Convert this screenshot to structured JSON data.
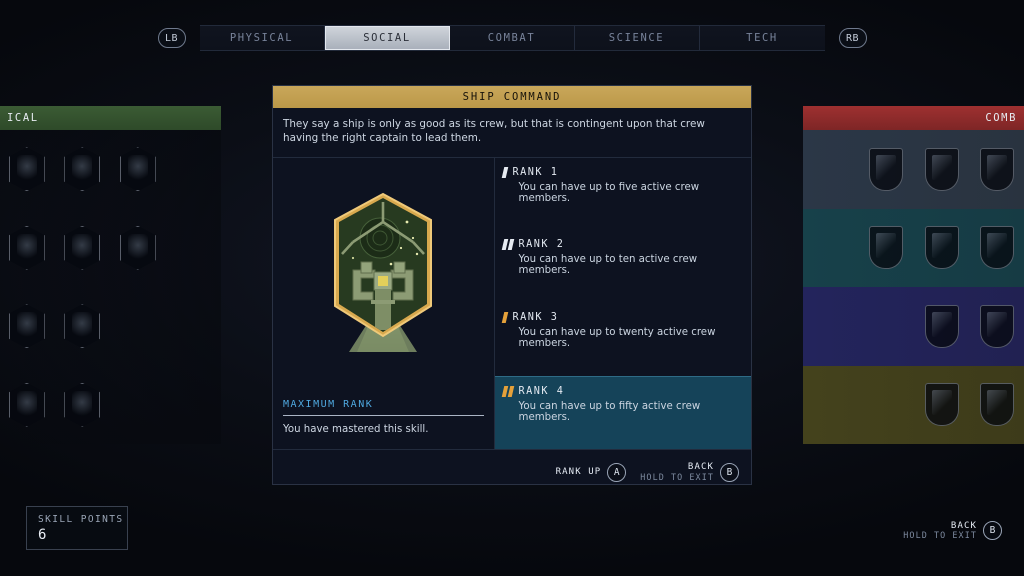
{
  "nav": {
    "left_bumper": "LB",
    "right_bumper": "RB",
    "tabs": [
      {
        "label": "PHYSICAL",
        "active": false
      },
      {
        "label": "SOCIAL",
        "active": true
      },
      {
        "label": "COMBAT",
        "active": false
      },
      {
        "label": "SCIENCE",
        "active": false
      },
      {
        "label": "TECH",
        "active": false
      }
    ]
  },
  "left_panel": {
    "header": "ICAL"
  },
  "right_panel": {
    "header": "COMB"
  },
  "skill": {
    "title": "SHIP COMMAND",
    "description": "They say a ship is only as good as its crew, but that is contingent upon that crew having the right captain to lead them.",
    "max_rank": {
      "title": "MAXIMUM RANK",
      "text": "You have mastered this skill."
    },
    "ranks": [
      {
        "label": "RANK 1",
        "desc": "You can have up to five active crew members.",
        "pips": 1,
        "pip_color": "silver",
        "current": false
      },
      {
        "label": "RANK 2",
        "desc": "You can have up to ten active crew members.",
        "pips": 2,
        "pip_color": "silver",
        "current": false
      },
      {
        "label": "RANK 3",
        "desc": "You can have up to twenty active crew members.",
        "pips": 1,
        "pip_color": "gold",
        "current": false
      },
      {
        "label": "RANK 4",
        "desc": "You can have up to fifty active crew members.",
        "pips": 2,
        "pip_color": "gold",
        "current": true
      }
    ]
  },
  "footer": {
    "rank_up": {
      "main": "RANK UP",
      "sub": "",
      "button": "A"
    },
    "back": {
      "main": "BACK",
      "sub": "HOLD TO EXIT",
      "button": "B"
    }
  },
  "skill_points": {
    "label": "SKILL POINTS",
    "value": "6"
  },
  "exit": {
    "main": "BACK",
    "sub": "HOLD TO EXIT",
    "button": "B"
  },
  "colors": {
    "title_bar": "#c9a75a",
    "accent_blue": "#4fa8df",
    "current_rank_bg": "#154359",
    "gold_pip": "#e5a13a",
    "physical_header": "#3b5b34",
    "combat_header": "#9e3030"
  }
}
